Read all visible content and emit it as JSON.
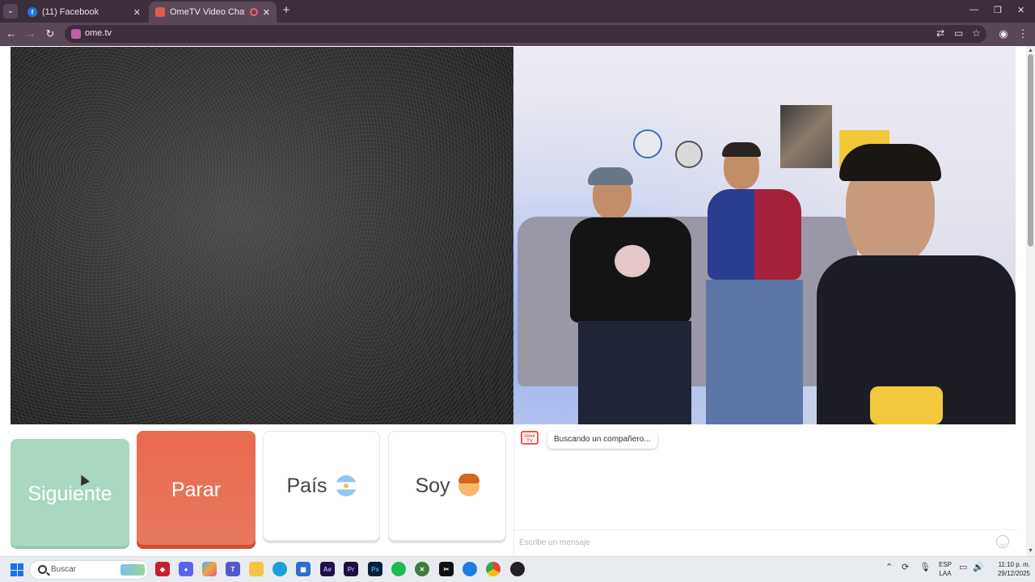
{
  "browser": {
    "tabs": [
      {
        "title": "(11) Facebook",
        "active": false,
        "favicon": "facebook-icon"
      },
      {
        "title": "OmeTV Video Chat — Ome",
        "active": true,
        "favicon": "ometv-icon",
        "recording": true
      }
    ],
    "address": "ome.tv"
  },
  "controls": {
    "next_label": "Siguiente",
    "stop_label": "Parar",
    "country_label": "País",
    "gender_label": "Soy"
  },
  "chat": {
    "logo_text": "Ome TV",
    "status": "Buscando un compañero...",
    "input_placeholder": "Escribe un mensaje"
  },
  "taskbar": {
    "search_placeholder": "Buscar",
    "language_line1": "ESP",
    "language_line2": "LAA",
    "time": "11:10 p. m.",
    "date": "29/12/2025"
  },
  "colors": {
    "next_button": "#a9d8c1",
    "stop_button": "#e96a4f",
    "browser_frame": "#3c2f3b"
  }
}
